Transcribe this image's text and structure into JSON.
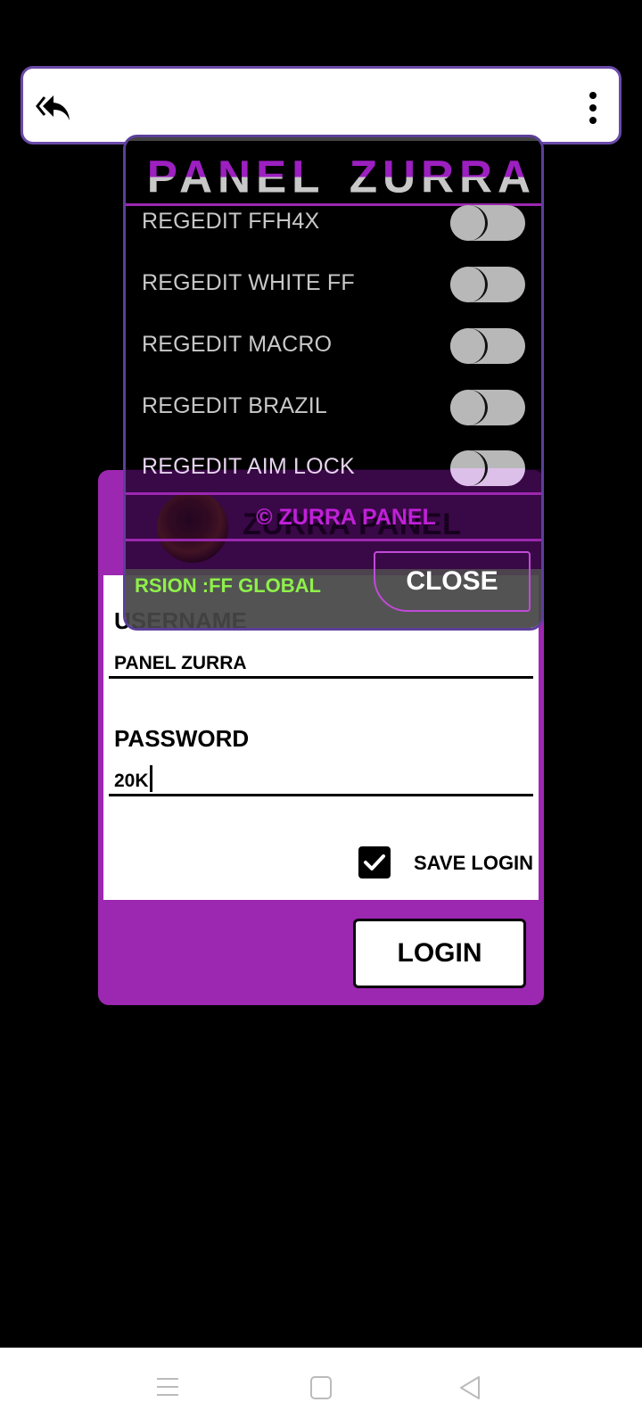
{
  "topbar": {
    "back_icon": "double-reply-back-icon",
    "more_icon": "vertical-ellipsis-icon"
  },
  "mod_menu": {
    "title_part1": "PANEL",
    "title_part2": "ZURRA",
    "colors": {
      "accent": "#9c27b0",
      "border": "#5b3f9a",
      "title_gray": "#c8c8c8",
      "title_purple": "#9c1fc0",
      "version_green": "#8ef04a"
    },
    "items": [
      {
        "label": "REGEDIT FFH4X",
        "enabled": false
      },
      {
        "label": "REGEDIT WHITE FF",
        "enabled": false
      },
      {
        "label": "REGEDIT MACRO",
        "enabled": false
      },
      {
        "label": "REGEDIT BRAZIL",
        "enabled": false
      },
      {
        "label": "REGEDIT AIM LOCK",
        "enabled": false
      }
    ],
    "copyright": "© ZURRA PANEL",
    "version": "RSION :FF GLOBAL",
    "close_label": "CLOSE"
  },
  "login": {
    "header_title": "ZURRA PANEL",
    "username_label": "USERNAME",
    "username_value": "PANEL ZURRA",
    "password_label": "PASSWORD",
    "password_value": "20K",
    "save_login_label": "SAVE LOGIN",
    "save_login_checked": true,
    "login_label": "LOGIN"
  },
  "navbar": {
    "recents_icon": "menu-lines-icon",
    "home_icon": "square-home-icon",
    "back_icon": "triangle-back-icon"
  }
}
